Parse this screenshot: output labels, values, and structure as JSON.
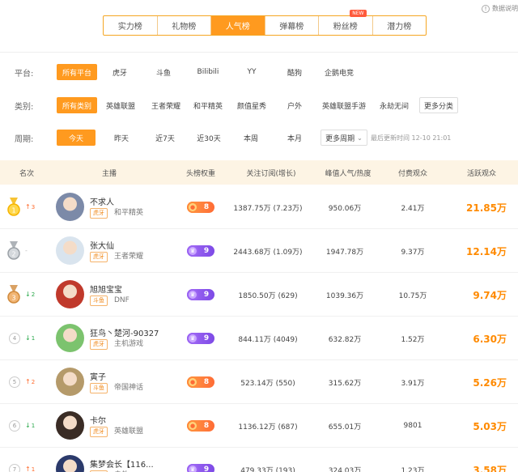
{
  "top_tabs": [
    {
      "label": "实力榜",
      "active": false
    },
    {
      "label": "礼物榜",
      "active": false
    },
    {
      "label": "人气榜",
      "active": true
    },
    {
      "label": "弹幕榜",
      "active": false
    },
    {
      "label": "粉丝榜",
      "active": false,
      "badge": "NEW"
    },
    {
      "label": "潜力榜",
      "active": false
    }
  ],
  "data_note": "数据说明",
  "filters": {
    "platform": {
      "label": "平台:",
      "options": [
        "所有平台",
        "虎牙",
        "斗鱼",
        "Bilibili",
        "YY",
        "酷狗",
        "企鹅电竞"
      ],
      "active_index": 0
    },
    "category": {
      "label": "类别:",
      "options": [
        "所有类别",
        "英雄联盟",
        "王者荣耀",
        "和平精英",
        "颜值星秀",
        "户外",
        "英雄联盟手游",
        "永劫无间"
      ],
      "more": "更多分类",
      "active_index": 0
    },
    "period": {
      "label": "周期:",
      "options": [
        "今天",
        "昨天",
        "近7天",
        "近30天",
        "本周",
        "本月"
      ],
      "more": "更多周期",
      "active_index": 0,
      "update_note": "最后更新时间 12-10 21:01"
    }
  },
  "table": {
    "headers": [
      "名次",
      "主播",
      "头榜权重",
      "关注订阅(增长)",
      "峰值人气/热度",
      "付费观众",
      "活跃观众"
    ],
    "rows": [
      {
        "rank": "1",
        "medal": "gold",
        "trend": "up",
        "trend_num": "3",
        "name": "不求人",
        "platform": "虎牙",
        "category": "和平精英",
        "weight": "8",
        "weight_type": "orange",
        "fans": "1387.75万 (7.23万)",
        "peak": "950.06万",
        "paid": "2.41万",
        "active": "21.85万",
        "avatar": "#7c8aa8"
      },
      {
        "rank": "2",
        "medal": "silver",
        "trend": "flat",
        "trend_num": "",
        "name": "张大仙",
        "platform": "虎牙",
        "category": "王者荣耀",
        "weight": "9",
        "weight_type": "purple",
        "fans": "2443.68万 (1.09万)",
        "peak": "1947.78万",
        "paid": "9.37万",
        "active": "12.14万",
        "avatar": "#d9e4ee"
      },
      {
        "rank": "3",
        "medal": "bronze",
        "trend": "down",
        "trend_num": "2",
        "name": "旭旭宝宝",
        "platform": "斗鱼",
        "category": "DNF",
        "weight": "9",
        "weight_type": "purple",
        "fans": "1850.50万 (629)",
        "peak": "1039.36万",
        "paid": "10.75万",
        "active": "9.74万",
        "avatar": "#c0392b"
      },
      {
        "rank": "4",
        "medal": "",
        "trend": "down",
        "trend_num": "1",
        "name": "狂鸟丶楚河-90327",
        "platform": "虎牙",
        "category": "主机游戏",
        "weight": "9",
        "weight_type": "purple",
        "fans": "844.11万 (4049)",
        "peak": "632.82万",
        "paid": "1.52万",
        "active": "6.30万",
        "avatar": "#7cc36e"
      },
      {
        "rank": "5",
        "medal": "",
        "trend": "up",
        "trend_num": "2",
        "name": "寅子",
        "platform": "斗鱼",
        "category": "帝国神话",
        "weight": "8",
        "weight_type": "orange",
        "fans": "523.14万 (550)",
        "peak": "315.62万",
        "paid": "3.91万",
        "active": "5.26万",
        "avatar": "#b59a6a"
      },
      {
        "rank": "6",
        "medal": "",
        "trend": "down",
        "trend_num": "1",
        "name": "卡尔",
        "platform": "虎牙",
        "category": "英雄联盟",
        "weight": "8",
        "weight_type": "orange",
        "fans": "1136.12万 (687)",
        "peak": "655.01万",
        "paid": "9801",
        "active": "5.03万",
        "avatar": "#3a2c25"
      },
      {
        "rank": "7",
        "medal": "",
        "trend": "up",
        "trend_num": "1",
        "name": "集梦会长【116...",
        "platform": "虎牙",
        "category": "户外",
        "weight": "9",
        "weight_type": "purple",
        "fans": "479.33万 (193)",
        "peak": "324.03万",
        "paid": "1.23万",
        "active": "3.58万",
        "avatar": "#2b3a6b"
      }
    ]
  }
}
